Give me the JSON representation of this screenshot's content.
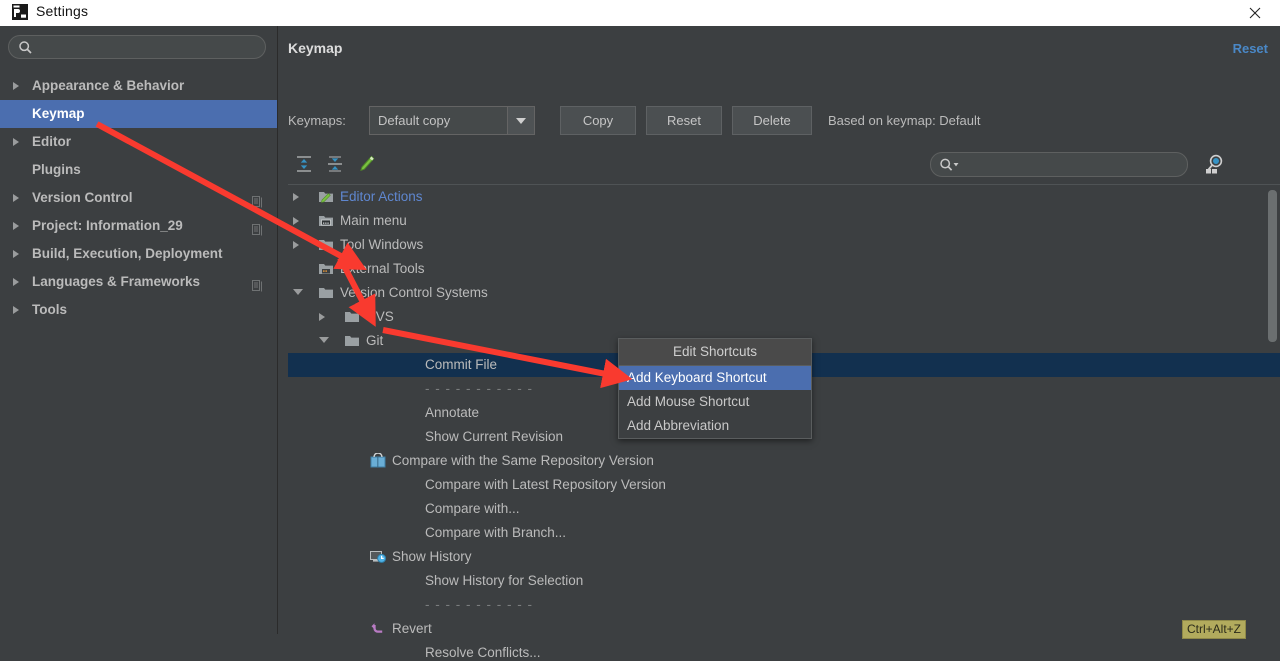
{
  "window": {
    "title": "Settings",
    "app_icon": "pycharm-logo-icon",
    "close_label": "✕"
  },
  "sidebar": {
    "search": {
      "value": "",
      "placeholder": ""
    },
    "items": [
      {
        "label": "Appearance & Behavior",
        "expandable": true,
        "selected": false,
        "has_config_icon": false,
        "indent": 0
      },
      {
        "label": "Keymap",
        "expandable": false,
        "selected": true,
        "has_config_icon": false,
        "indent": 1
      },
      {
        "label": "Editor",
        "expandable": true,
        "selected": false,
        "has_config_icon": false,
        "indent": 0
      },
      {
        "label": "Plugins",
        "expandable": false,
        "selected": false,
        "has_config_icon": false,
        "indent": 1
      },
      {
        "label": "Version Control",
        "expandable": true,
        "selected": false,
        "has_config_icon": true,
        "indent": 0
      },
      {
        "label": "Project: Information_29",
        "expandable": true,
        "selected": false,
        "has_config_icon": true,
        "indent": 0
      },
      {
        "label": "Build, Execution, Deployment",
        "expandable": true,
        "selected": false,
        "has_config_icon": false,
        "indent": 0
      },
      {
        "label": "Languages & Frameworks",
        "expandable": true,
        "selected": false,
        "has_config_icon": true,
        "indent": 0
      },
      {
        "label": "Tools",
        "expandable": true,
        "selected": false,
        "has_config_icon": false,
        "indent": 0
      }
    ]
  },
  "main": {
    "title": "Keymap",
    "reset_link": "Reset",
    "keymaps_label": "Keymaps:",
    "keymap_selected": "Default copy",
    "keymap_options": [
      "Default copy"
    ],
    "buttons": {
      "copy": "Copy",
      "reset": "Reset",
      "delete": "Delete"
    },
    "based_on": "Based on keymap: Default",
    "toolbar_icons": [
      "expand-all-icon",
      "collapse-all-icon",
      "edit-pencil-icon"
    ],
    "find_search": {
      "value": "",
      "placeholder": ""
    },
    "find_by_shortcut_icon": "find-by-shortcut-icon"
  },
  "tree": {
    "rows": [
      {
        "label": "Editor Actions",
        "indent": 0,
        "expander": "closed",
        "icon": "editor-actions-folder-icon",
        "blue": true,
        "selected": false,
        "separator": false,
        "shortcut": ""
      },
      {
        "label": "Main menu",
        "indent": 0,
        "expander": "closed",
        "icon": "main-menu-folder-icon",
        "blue": false,
        "selected": false,
        "separator": false,
        "shortcut": ""
      },
      {
        "label": "Tool Windows",
        "indent": 0,
        "expander": "closed",
        "icon": "folder-icon",
        "blue": false,
        "selected": false,
        "separator": false,
        "shortcut": ""
      },
      {
        "label": "External Tools",
        "indent": 0,
        "expander": "none",
        "icon": "external-tools-folder-icon",
        "blue": false,
        "selected": false,
        "separator": false,
        "shortcut": ""
      },
      {
        "label": "Version Control Systems",
        "indent": 0,
        "expander": "open",
        "icon": "folder-icon",
        "blue": false,
        "selected": false,
        "separator": false,
        "shortcut": ""
      },
      {
        "label": "CVS",
        "indent": 1,
        "expander": "closed",
        "icon": "folder-icon",
        "blue": false,
        "selected": false,
        "separator": false,
        "shortcut": ""
      },
      {
        "label": "Git",
        "indent": 1,
        "expander": "open",
        "icon": "folder-icon",
        "blue": false,
        "selected": false,
        "separator": false,
        "shortcut": ""
      },
      {
        "label": "Commit File",
        "indent": 2,
        "expander": "none",
        "icon": "none",
        "blue": false,
        "selected": true,
        "separator": false,
        "shortcut": ""
      },
      {
        "label": "- - - - - - - - - - -",
        "indent": 2,
        "expander": "none",
        "icon": "none",
        "blue": false,
        "selected": false,
        "separator": true,
        "shortcut": ""
      },
      {
        "label": "Annotate",
        "indent": 2,
        "expander": "none",
        "icon": "none",
        "blue": false,
        "selected": false,
        "separator": false,
        "shortcut": ""
      },
      {
        "label": "Show Current Revision",
        "indent": 2,
        "expander": "none",
        "icon": "none",
        "blue": false,
        "selected": false,
        "separator": false,
        "shortcut": ""
      },
      {
        "label": "Compare with the Same Repository Version",
        "indent": 2,
        "expander": "none",
        "icon": "compare-icon",
        "blue": false,
        "selected": false,
        "separator": false,
        "shortcut": ""
      },
      {
        "label": "Compare with Latest Repository Version",
        "indent": 2,
        "expander": "none",
        "icon": "none",
        "blue": false,
        "selected": false,
        "separator": false,
        "shortcut": ""
      },
      {
        "label": "Compare with...",
        "indent": 2,
        "expander": "none",
        "icon": "none",
        "blue": false,
        "selected": false,
        "separator": false,
        "shortcut": ""
      },
      {
        "label": "Compare with Branch...",
        "indent": 2,
        "expander": "none",
        "icon": "none",
        "blue": false,
        "selected": false,
        "separator": false,
        "shortcut": ""
      },
      {
        "label": "Show History",
        "indent": 2,
        "expander": "none",
        "icon": "show-history-icon",
        "blue": false,
        "selected": false,
        "separator": false,
        "shortcut": ""
      },
      {
        "label": "Show History for Selection",
        "indent": 2,
        "expander": "none",
        "icon": "none",
        "blue": false,
        "selected": false,
        "separator": false,
        "shortcut": ""
      },
      {
        "label": "- - - - - - - - - - -",
        "indent": 2,
        "expander": "none",
        "icon": "none",
        "blue": false,
        "selected": false,
        "separator": true,
        "shortcut": ""
      },
      {
        "label": "Revert",
        "indent": 2,
        "expander": "none",
        "icon": "revert-icon",
        "blue": false,
        "selected": false,
        "separator": false,
        "shortcut": "Ctrl+Alt+Z"
      },
      {
        "label": "Resolve Conflicts...",
        "indent": 2,
        "expander": "none",
        "icon": "none",
        "blue": false,
        "selected": false,
        "separator": false,
        "shortcut": ""
      }
    ]
  },
  "context_menu": {
    "title": "Edit Shortcuts",
    "items": [
      {
        "label": "Add Keyboard Shortcut",
        "highlighted": true
      },
      {
        "label": "Add Mouse Shortcut",
        "highlighted": false
      },
      {
        "label": "Add Abbreviation",
        "highlighted": false
      }
    ]
  },
  "colors": {
    "window_bg": "#3c3f41",
    "selection_blue": "#4b6eaf",
    "tree_selection": "#12304f",
    "link_blue": "#4a88c7",
    "shortcut_badge_bg": "#b2ab5d",
    "annotation_red": "#f93a2f"
  }
}
